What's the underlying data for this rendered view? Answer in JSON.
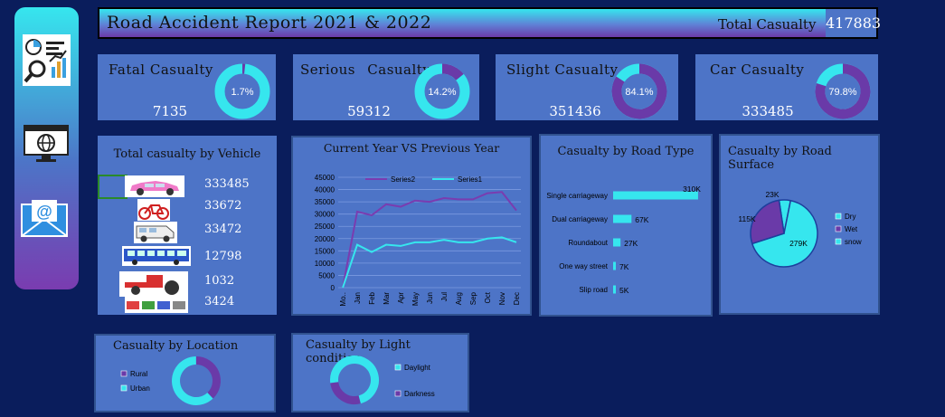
{
  "header": {
    "title": "Road Accident Report 2021 & 2022",
    "total_label": "Total Casualty",
    "total_value": "417883"
  },
  "sidebar": {
    "icons": [
      "dashboard-report-icon",
      "web-globe-icon",
      "email-icon"
    ]
  },
  "kpis": [
    {
      "title": "Fatal Casualty",
      "value": "7135",
      "pct_label": "1.7%",
      "pct": 1.7
    },
    {
      "title": "Serious Casualty",
      "value": "59312",
      "pct_label": "14.2%",
      "pct": 14.2
    },
    {
      "title": "Slight Casualty",
      "value": "351436",
      "pct_label": "84.1%",
      "pct": 84.1
    },
    {
      "title": "Car Casualty",
      "value": "333485",
      "pct_label": "79.8%",
      "pct": 79.8
    }
  ],
  "vehicle": {
    "title": "Total casualty by Vehicle",
    "items": [
      {
        "icon": "car-icon",
        "value": "333485"
      },
      {
        "icon": "bicycle-icon",
        "value": "33672"
      },
      {
        "icon": "van-icon",
        "value": "33472"
      },
      {
        "icon": "bus-icon",
        "value": "12798"
      },
      {
        "icon": "tractor-icon",
        "value": "1032"
      },
      {
        "icon": "other-vehicles-icon",
        "value": "3424"
      }
    ]
  },
  "colors": {
    "background": "#0a1d5c",
    "panel": "#4d74c7",
    "cyan": "#36e6ee",
    "purple": "#6a3aa8",
    "header_gradient_start": "#ffffff",
    "header_gradient_end": "#6a3aa8"
  },
  "chart_data": [
    {
      "id": "cy-vs-py",
      "type": "line",
      "title": "Current Year VS Previous Year",
      "legend": "top",
      "categories": [
        "Mo..",
        "Jan",
        "Feb",
        "Mar",
        "Apr",
        "May",
        "Jun",
        "Jul",
        "Aug",
        "Sep",
        "Oct",
        "Nov",
        "Dec"
      ],
      "series": [
        {
          "name": "Series2",
          "color": "#7a3cb0",
          "values": [
            0,
            31000,
            29500,
            34000,
            33000,
            35500,
            35000,
            36500,
            36000,
            36000,
            38500,
            39000,
            31500
          ]
        },
        {
          "name": "Series1",
          "color": "#36e6ee",
          "values": [
            0,
            17500,
            14500,
            17500,
            17000,
            18500,
            18500,
            19500,
            18500,
            18500,
            20000,
            20500,
            18500
          ]
        }
      ],
      "yticks": [
        "45000",
        "40000",
        "35000",
        "30000",
        "25000",
        "20000",
        "15000",
        "10000",
        "5000",
        "0"
      ],
      "ylim": [
        0,
        45000
      ],
      "grid": true
    },
    {
      "id": "road-type",
      "type": "bar",
      "orientation": "horizontal",
      "title": "Casualty by Road Type",
      "categories": [
        "Single carriageway",
        "Dual carriageway",
        "Roundabout",
        "One way street",
        "Slip road"
      ],
      "values": [
        310,
        67,
        27,
        7,
        5
      ],
      "labels": [
        "310K",
        "67K",
        "27K",
        "7K",
        "5K"
      ],
      "unit": "K",
      "xlim": [
        0,
        330
      ]
    },
    {
      "id": "road-surface",
      "type": "pie",
      "title": "Casualty by Road Surface",
      "categories": [
        "Dry",
        "Wet",
        "snow"
      ],
      "values": [
        279,
        115,
        23
      ],
      "labels": [
        "279K",
        "115K",
        "23K"
      ],
      "colors": [
        "#36e6ee",
        "#6a3aa8",
        "#36e6ee"
      ],
      "legend": "right"
    },
    {
      "id": "location",
      "type": "pie",
      "donut": true,
      "title": "Casualty by Location",
      "categories": [
        "Rural",
        "Urban"
      ],
      "values": [
        38,
        62
      ],
      "colors": [
        "#6a3aa8",
        "#36e6ee"
      ],
      "legend": "left"
    },
    {
      "id": "light",
      "type": "pie",
      "donut": true,
      "title": "Casualty by Light condition",
      "categories": [
        "Daylight",
        "Darkness"
      ],
      "values": [
        73,
        27
      ],
      "colors": [
        "#36e6ee",
        "#6a3aa8"
      ],
      "legend": "right"
    }
  ]
}
